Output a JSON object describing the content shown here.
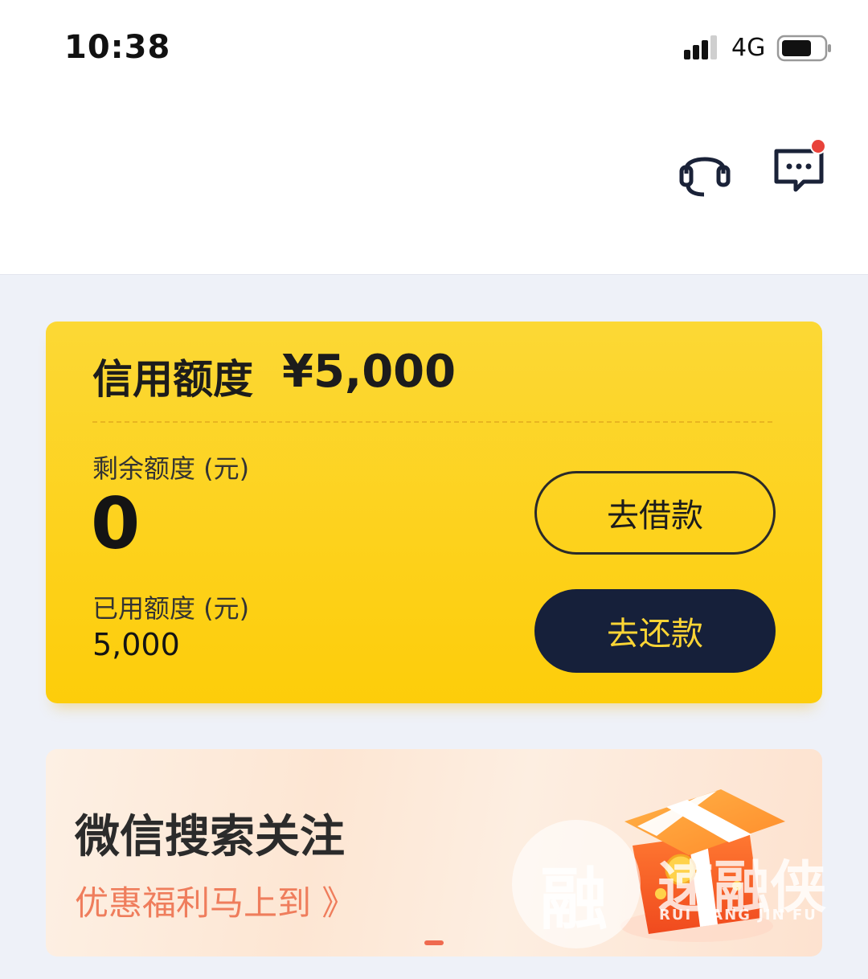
{
  "status_bar": {
    "time": "10:38",
    "network": "4G"
  },
  "header": {
    "icons": [
      "headset-icon",
      "message-icon"
    ],
    "notification_dot_color": "#e8423a"
  },
  "credit_card": {
    "title": "信用额度",
    "amount": "¥5,000",
    "remaining_label": "剩余额度 (元)",
    "remaining_value": "0",
    "used_label": "已用额度 (元)",
    "used_value": "5,000",
    "borrow_button": "去借款",
    "repay_button": "去还款",
    "card_color": "#fdd21d",
    "repay_button_color": "#16203a"
  },
  "banner": {
    "title": "微信搜索关注",
    "subtitle": "优惠福利马上到 》",
    "icon": "gift-box-icon",
    "subtitle_color": "#ef7d5c"
  },
  "watermark": {
    "glyph": "融",
    "text": "速融侠",
    "subtext": "RUI BANG JIN FU"
  }
}
